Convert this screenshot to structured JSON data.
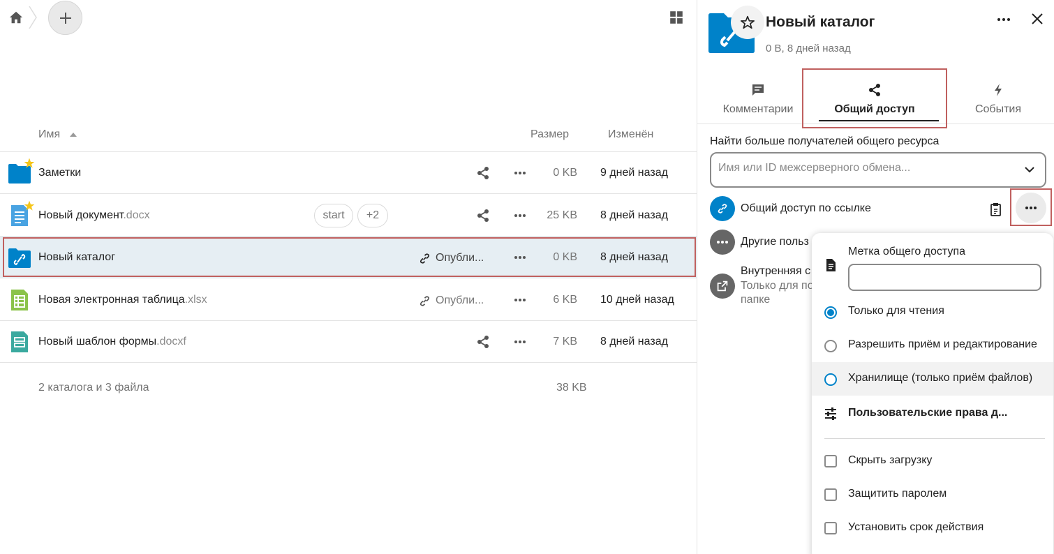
{
  "colors": {
    "accent": "#0082c9",
    "highlight_border": "#c0605f",
    "folder": "#0082c9",
    "star": "#f5c518"
  },
  "table": {
    "col_name": "Имя",
    "col_size": "Размер",
    "col_modified": "Изменён",
    "rows": [
      {
        "name": "Заметки",
        "ext": "",
        "size": "0 KB",
        "modified": "9 дней назад",
        "icon": "folder-icon",
        "starred": true,
        "shared": false,
        "public": ""
      },
      {
        "name": "Новый документ",
        "ext": ".docx",
        "size": "25 KB",
        "modified": "8 дней назад",
        "icon": "document-icon",
        "starred": true,
        "shared": false,
        "public": "",
        "tags": [
          "start",
          "+2"
        ]
      },
      {
        "name": "Новый каталог",
        "ext": "",
        "size": "0 KB",
        "modified": "8 дней назад",
        "icon": "link-folder-icon",
        "starred": false,
        "shared": true,
        "public": "Опубли...",
        "selected": true
      },
      {
        "name": "Новая электронная таблица",
        "ext": ".xlsx",
        "size": "6 KB",
        "modified": "10 дней назад",
        "icon": "spreadsheet-icon",
        "starred": false,
        "shared": true,
        "public": "Опубли..."
      },
      {
        "name": "Новый шаблон формы",
        "ext": ".docxf",
        "size": "7 KB",
        "modified": "8 дней назад",
        "icon": "form-template-icon",
        "starred": false,
        "shared": false,
        "public": ""
      }
    ],
    "summary": "2 каталога и 3 файла",
    "summary_size": "38 KB"
  },
  "sidebar": {
    "title": "Новый каталог",
    "subtitle": "0 B, 8 дней назад",
    "tabs": [
      {
        "label": "Комментарии",
        "icon": "comment-icon"
      },
      {
        "label": "Общий доступ",
        "icon": "share-icon",
        "active": true
      },
      {
        "label": "События",
        "icon": "activity-icon"
      }
    ],
    "find_label": "Найти больше получателей общего ресурса",
    "search_placeholder": "Имя или ID межсерверного обмена...",
    "link_share": "Общий доступ по ссылке",
    "other_users": "Другие польз",
    "internal_title": "Внутренняя с",
    "internal_line2": "Только для по",
    "internal_line3": "папке"
  },
  "popup": {
    "label_title": "Метка общего доступа",
    "label_value": "",
    "options": [
      "Только для чтения",
      "Разрешить приём и редактирование",
      "Хранилище (только приём файлов)"
    ],
    "selected_option": 0,
    "custom_perms": "Пользовательские права д...",
    "checkboxes": [
      "Скрыть загрузку",
      "Защитить паролем",
      "Установить срок действия"
    ]
  }
}
